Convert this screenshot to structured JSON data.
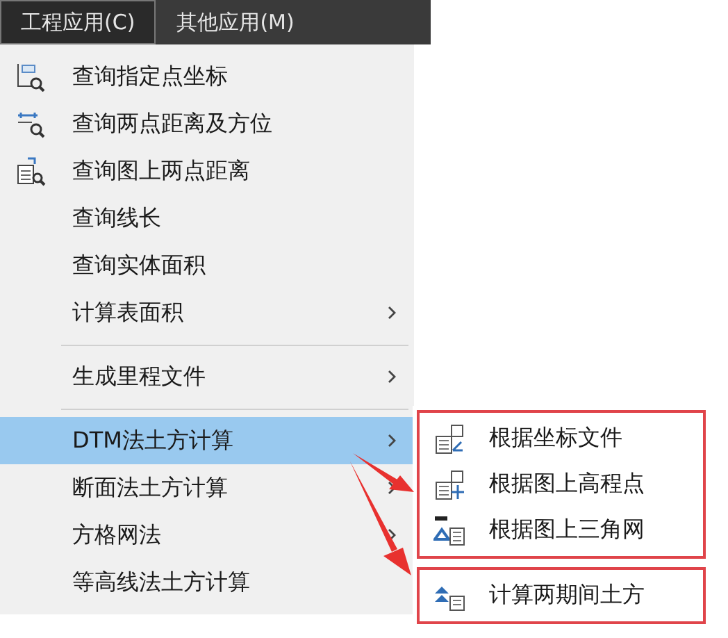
{
  "menubar": [
    {
      "label": "工程应用(C)",
      "selected": true
    },
    {
      "label": "其他应用(M)",
      "selected": false
    }
  ],
  "menu": {
    "sections": [
      [
        {
          "label": "查询指定点坐标",
          "submenu": false,
          "selected": false
        },
        {
          "label": "查询两点距离及方位",
          "submenu": false,
          "selected": false
        },
        {
          "label": "查询图上两点距离",
          "submenu": false,
          "selected": false
        },
        {
          "label": "查询线长",
          "submenu": false,
          "selected": false
        },
        {
          "label": "查询实体面积",
          "submenu": false,
          "selected": false
        },
        {
          "label": "计算表面积",
          "submenu": true,
          "selected": false
        }
      ],
      [
        {
          "label": "生成里程文件",
          "submenu": true,
          "selected": false
        }
      ],
      [
        {
          "label": "DTM法土方计算",
          "submenu": true,
          "selected": true
        },
        {
          "label": "断面法土方计算",
          "submenu": true,
          "selected": false
        },
        {
          "label": "方格网法",
          "submenu": true,
          "selected": false
        },
        {
          "label": "等高线法土方计算",
          "submenu": false,
          "selected": false
        }
      ]
    ]
  },
  "submenu": {
    "groups": [
      [
        {
          "label": "根据坐标文件"
        },
        {
          "label": "根据图上高程点"
        },
        {
          "label": "根据图上三角网"
        }
      ],
      [
        {
          "label": "计算两期间土方"
        }
      ]
    ]
  }
}
